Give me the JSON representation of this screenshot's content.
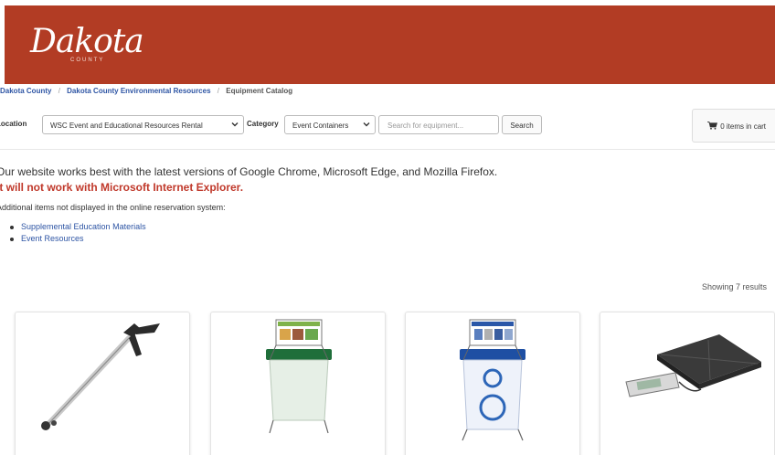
{
  "header": {
    "logo_text": "Dakota",
    "logo_sub": "COUNTY",
    "brand_color": "#b23c24"
  },
  "breadcrumb": {
    "items": [
      "Dakota County",
      "Dakota County Environmental Resources"
    ],
    "current": "Equipment Catalog"
  },
  "filters": {
    "location_label": "Location",
    "location_value": "WSC Event and Educational Resources Rental",
    "category_label": "Category",
    "category_value": "Event Containers",
    "search_placeholder": "Search for equipment...",
    "search_button": "Search"
  },
  "cart": {
    "label": "0 items in cart",
    "icon": "cart-icon"
  },
  "notice": {
    "browser_text": "Our website works best with the latest versions of Google Chrome, Microsoft Edge, and Mozilla Firefox.",
    "warning_text": "It will not work with Microsoft Internet Explorer.",
    "warning_color": "#c0392b",
    "additional_text": "Additional items not displayed in the online reservation system:"
  },
  "links": [
    "Supplemental Education Materials",
    "Event Resources"
  ],
  "results_text": "Showing 7 results",
  "products": [
    {
      "image": "litter-grabber-image"
    },
    {
      "image": "organics-container-image"
    },
    {
      "image": "recycle-container-image"
    },
    {
      "image": "digital-scale-image"
    }
  ]
}
